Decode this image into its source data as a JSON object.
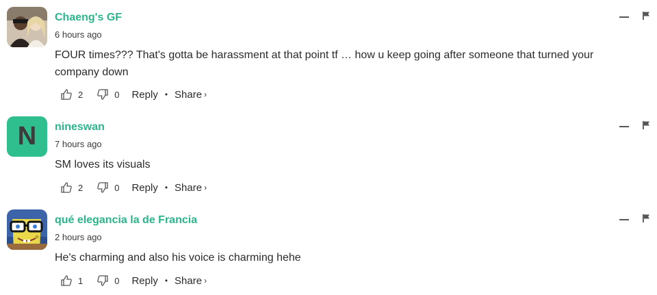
{
  "comments": [
    {
      "author": "Chaeng's GF",
      "time": "6 hours ago",
      "text": "FOUR times??? That's gotta be harassment at that point tf … how u keep going after someone that turned your company down",
      "likes": "2",
      "dislikes": "0",
      "reply_label": "Reply",
      "share_label": "Share",
      "avatar": "photo"
    },
    {
      "author": "nineswan",
      "time": "7 hours ago",
      "text": "SM loves its visuals",
      "likes": "2",
      "dislikes": "0",
      "reply_label": "Reply",
      "share_label": "Share",
      "avatar": "initial",
      "avatar_letter": "N",
      "avatar_color": "#2fbf8f"
    },
    {
      "author": "qué elegancia la de Francia",
      "time": "2 hours ago",
      "text": "He's charming and also his voice is charming hehe",
      "likes": "1",
      "dislikes": "0",
      "reply_label": "Reply",
      "share_label": "Share",
      "avatar": "cartoon"
    }
  ],
  "separator": "•",
  "share_chevron": "›",
  "colors": {
    "author": "#2bb58a",
    "text": "#2a2a2a",
    "icon": "#555555"
  }
}
